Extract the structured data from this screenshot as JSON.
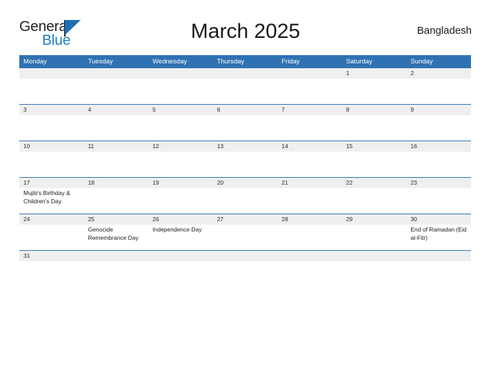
{
  "brand": {
    "word_one": "General",
    "word_two": "Blue",
    "flag_icon": "blue-triangle-flag-icon",
    "accent_color": "#1f7dc0"
  },
  "header": {
    "title": "March 2025",
    "country": "Bangladesh"
  },
  "theme": {
    "header_blue": "#2f72b3",
    "row_gray": "#efefef",
    "text_dark": "#1a1a1a"
  },
  "weekday_headers": [
    "Monday",
    "Tuesday",
    "Wednesday",
    "Thursday",
    "Friday",
    "Saturday",
    "Sunday"
  ],
  "weeks": [
    {
      "days": [
        {
          "num": "",
          "event": ""
        },
        {
          "num": "",
          "event": ""
        },
        {
          "num": "",
          "event": ""
        },
        {
          "num": "",
          "event": ""
        },
        {
          "num": "",
          "event": ""
        },
        {
          "num": "1",
          "event": ""
        },
        {
          "num": "2",
          "event": ""
        }
      ]
    },
    {
      "days": [
        {
          "num": "3",
          "event": ""
        },
        {
          "num": "4",
          "event": ""
        },
        {
          "num": "5",
          "event": ""
        },
        {
          "num": "6",
          "event": ""
        },
        {
          "num": "7",
          "event": ""
        },
        {
          "num": "8",
          "event": ""
        },
        {
          "num": "9",
          "event": ""
        }
      ]
    },
    {
      "days": [
        {
          "num": "10",
          "event": ""
        },
        {
          "num": "11",
          "event": ""
        },
        {
          "num": "12",
          "event": ""
        },
        {
          "num": "13",
          "event": ""
        },
        {
          "num": "14",
          "event": ""
        },
        {
          "num": "15",
          "event": ""
        },
        {
          "num": "16",
          "event": ""
        }
      ]
    },
    {
      "days": [
        {
          "num": "17",
          "event": "Mujib's Birthday & Children's Day"
        },
        {
          "num": "18",
          "event": ""
        },
        {
          "num": "19",
          "event": ""
        },
        {
          "num": "20",
          "event": ""
        },
        {
          "num": "21",
          "event": ""
        },
        {
          "num": "22",
          "event": ""
        },
        {
          "num": "23",
          "event": ""
        }
      ]
    },
    {
      "days": [
        {
          "num": "24",
          "event": ""
        },
        {
          "num": "25",
          "event": "Genocide Remembrance Day"
        },
        {
          "num": "26",
          "event": "Independence Day"
        },
        {
          "num": "27",
          "event": ""
        },
        {
          "num": "28",
          "event": ""
        },
        {
          "num": "29",
          "event": ""
        },
        {
          "num": "30",
          "event": "End of Ramadan (Eid al-Fitr)"
        }
      ]
    },
    {
      "days": [
        {
          "num": "31",
          "event": ""
        },
        {
          "num": "",
          "event": ""
        },
        {
          "num": "",
          "event": ""
        },
        {
          "num": "",
          "event": ""
        },
        {
          "num": "",
          "event": ""
        },
        {
          "num": "",
          "event": ""
        },
        {
          "num": "",
          "event": ""
        }
      ]
    }
  ]
}
